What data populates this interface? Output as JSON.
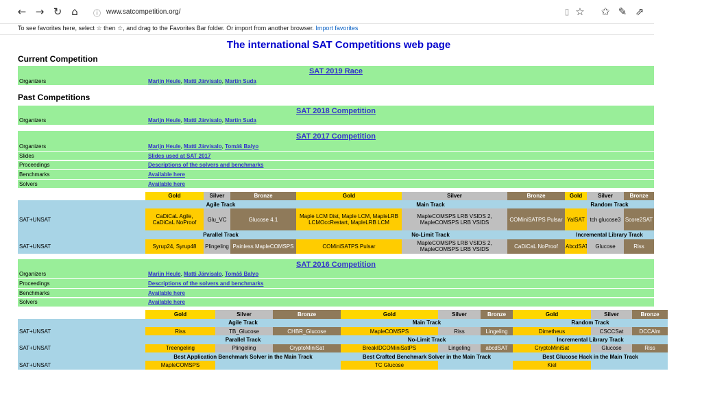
{
  "browser": {
    "url": "www.satcompetition.org/",
    "fav_prompt": "To see favorites here, select ☆ then ☆, and drag to the Favorites Bar folder. Or import from another browser.",
    "import_link": "Import favorites",
    "icons": [
      "back-icon",
      "forward-icon",
      "refresh-icon",
      "home-icon",
      "info-icon",
      "reading-view-icon",
      "favorite-star-icon",
      "favorites-list-icon",
      "pen-icon",
      "share-icon"
    ]
  },
  "page": {
    "title": "The international SAT Competitions web page",
    "current_heading": "Current Competition",
    "past_heading": "Past Competitions"
  },
  "c2019": {
    "title": "SAT 2019 Race",
    "organizers_label": "Organizers",
    "organizers": [
      "Marijn Heule",
      "Matti Järvisalo",
      "Martin Suda"
    ]
  },
  "c2018": {
    "title": "SAT 2018 Competition",
    "organizers_label": "Organizers",
    "organizers": [
      "Marijn Heule",
      "Matti Järvisalo",
      "Martin Suda"
    ]
  },
  "c2017": {
    "title": "SAT 2017 Competition",
    "organizers_label": "Organizers",
    "organizers": [
      "Marijn Heule",
      "Matti Järvisalo",
      "Tomáš Balyo"
    ],
    "slides_label": "Slides",
    "slides": "Slides used at SAT 2017",
    "proceedings_label": "Proceedings",
    "proceedings": "Descriptions of the solvers and benchmarks",
    "benchmarks_label": "Benchmarks",
    "benchmarks": "Available here",
    "solvers_label": "Solvers",
    "solvers": "Available here",
    "results": {
      "medals": [
        "Gold",
        "Silver",
        "Bronze",
        "Gold",
        "Silver",
        "Bronze",
        "Gold",
        "Silver",
        "Bronze"
      ],
      "row_label": "SAT+UNSAT",
      "agile_track": "Agile Track",
      "main_track": "Main Track",
      "random_track": "Random Track",
      "agile": [
        "CaDiCaL Agile, CaDiCaL NoProof",
        "Glu_VC",
        "Glucose 4.1"
      ],
      "main": [
        "Maple LCM Dist, Maple LCM, MapleLRB LCMOccRestart, MapleLRB LCM",
        "MapleCOMSPS LRB VSIDS 2, MapleCOMSPS LRB VSIDS",
        "COMiniSATPS Pulsar"
      ],
      "random": [
        "YalSAT",
        "tch glucose3",
        "Score2SAT"
      ],
      "parallel_track": "Parallel Track",
      "nolimit_track": "No-Limit Track",
      "incremental_track": "Incremental Library Track",
      "parallel": [
        "Syrup24, Syrup48",
        "Plingeling",
        "Painless MapleCOMSPS"
      ],
      "nolimit": [
        "COMiniSATPS Pulsar",
        "MapleCOMSPS LRB VSIDS 2, MapleCOMSPS LRB VSIDS",
        "CaDiCaL NoProof"
      ],
      "incremental": [
        "AbcdSAT",
        "Glucose",
        "Riss"
      ]
    }
  },
  "c2016": {
    "title": "SAT 2016 Competition",
    "organizers_label": "Organizers",
    "organizers": [
      "Marijn Heule",
      "Matti Järvisalo",
      "Tomáš Balyo"
    ],
    "proceedings_label": "Proceedings",
    "proceedings": "Descriptions of the solvers and benchmarks",
    "benchmarks_label": "Benchmarks",
    "benchmarks": "Available here",
    "solvers_label": "Solvers",
    "solvers": "Available here",
    "results": {
      "medals": [
        "Gold",
        "Silver",
        "Bronze",
        "Gold",
        "Silver",
        "Bronze",
        "Gold",
        "Silver",
        "Bronze"
      ],
      "row_label": "SAT+UNSAT",
      "agile_track": "Agile Track",
      "main_track": "Main Track",
      "random_track": "Random Track",
      "agile": [
        "Riss",
        "TB_Glucose",
        "CHBR_Glucose"
      ],
      "main": [
        "MapleCOMSPS",
        "Riss",
        "Lingeling"
      ],
      "random": [
        "Dimetheus",
        "CSCCSat",
        "DCCAlm"
      ],
      "parallel_track": "Parallel Track",
      "nolimit_track": "No-Limit Track",
      "incremental_track": "Incremental Library Track",
      "parallel": [
        "Treengeling",
        "Plingeling",
        "CryptoMiniSat"
      ],
      "nolimit": [
        "BreakIDCOMiniSatPS",
        "Lingeling",
        "abcdSAT"
      ],
      "incremental": [
        "CryptoMiniSat",
        "Glucose",
        "Riss"
      ],
      "best_app": "Best Application Benchmark Solver in the Main Track",
      "best_crafted": "Best Crafted Benchmark Solver in the Main Track",
      "best_hack": "Best Glucose Hack in the Main Track",
      "best": [
        "MapleCOMSPS",
        "TC Glucose",
        "Kiel"
      ]
    }
  }
}
